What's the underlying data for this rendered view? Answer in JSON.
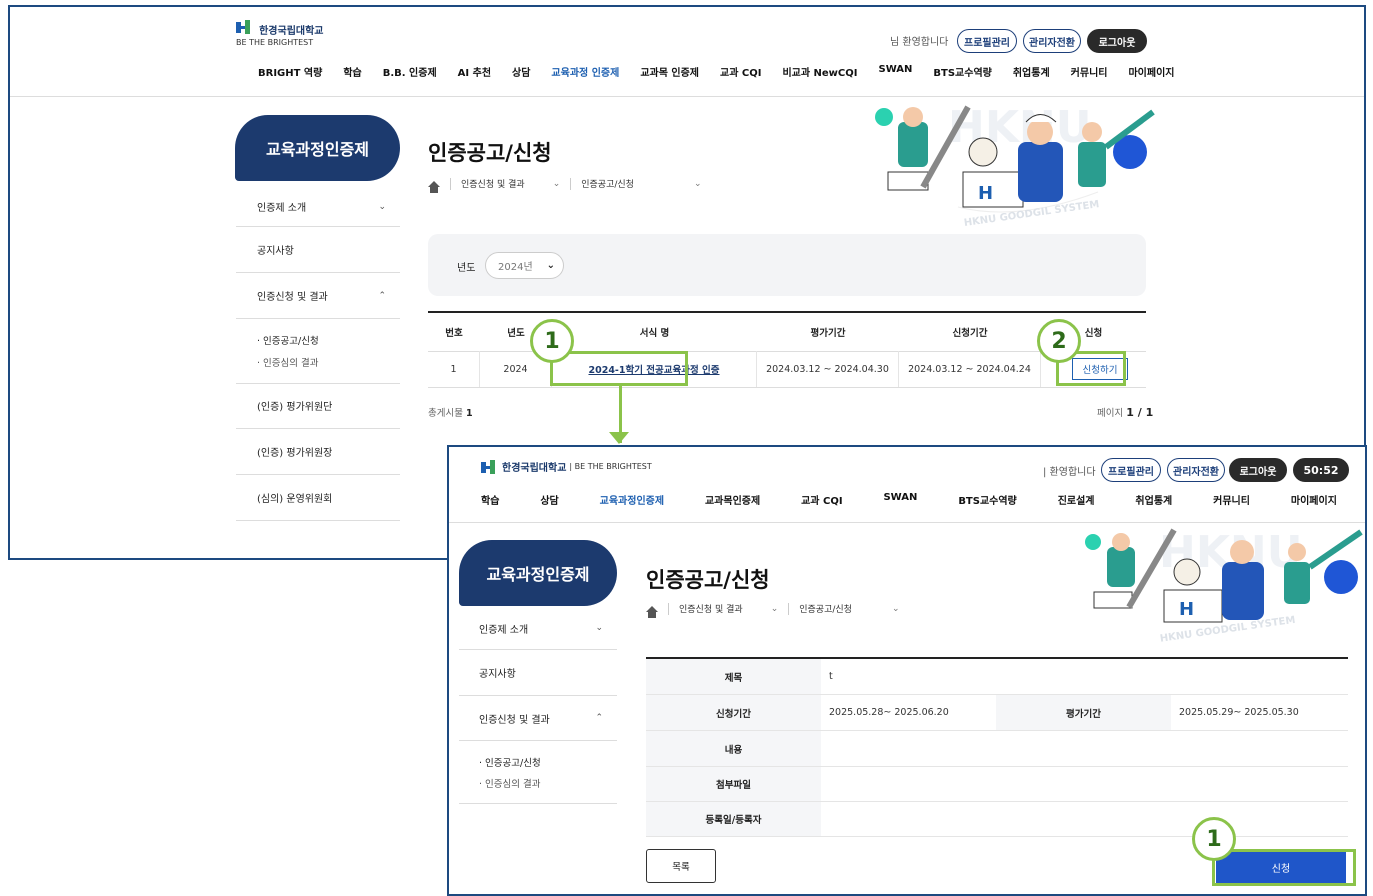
{
  "common": {
    "logo_text": "한경국립대학교",
    "logo_sub": "BE THE BRIGHTEST",
    "welcome": "님 환영합니다",
    "profile_btn": "프로필관리",
    "admin_btn": "관리자전환",
    "logout_btn": "로그아웃",
    "side_title": "교육과정인증제",
    "page_title": "인증공고/신청",
    "crumb1": "인증신청 및 결과",
    "crumb2": "인증공고/신청",
    "illus_text": "HKNU GOODGIL SYSTEM"
  },
  "shot1": {
    "nav": [
      "BRIGHT 역량",
      "학습",
      "B.B. 인증제",
      "AI 추천",
      "상담",
      "교육과정 인증제",
      "교과목 인증제",
      "교과 CQI",
      "비교과 NewCQI",
      "SWAN",
      "BTS교수역량",
      "취업통계",
      "커뮤니티",
      "마이페이지"
    ],
    "nav_active_index": 5,
    "sidebar": [
      "인증제 소개",
      "공지사항",
      "인증신청 및 결과",
      "(인증) 평가위원단",
      "(인증) 평가위원장",
      "(심의) 운영위원회"
    ],
    "sidebar_sub": [
      "인증공고/신청",
      "인증심의 결과"
    ],
    "filter_label": "년도",
    "filter_value": "2024년",
    "table_headers": [
      "번호",
      "년도",
      "서식 명",
      "평가기간",
      "신청기간",
      "신청"
    ],
    "row": {
      "no": "1",
      "year": "2024",
      "name": "2024-1학기 전공교육과정 인증",
      "eval": "2024.03.12 ~ 2024.04.30",
      "apply": "2024.03.12 ~ 2024.04.24",
      "btn": "신청하기"
    },
    "total_label": "총게시물",
    "total_value": "1",
    "page_label": "페이지",
    "page_value": "1 / 1",
    "callout1": "1",
    "callout2": "2"
  },
  "shot2": {
    "welcome": "| 환영합니다",
    "timer": "50:52",
    "logo_sub": "| BE THE BRIGHTEST",
    "nav": [
      "학습",
      "상담",
      "교육과정인증제",
      "교과목인증제",
      "교과 CQI",
      "SWAN",
      "BTS교수역량",
      "진로설계",
      "취업통계",
      "커뮤니티",
      "마이페이지"
    ],
    "nav_active_index": 2,
    "sidebar": [
      "인증제 소개",
      "공지사항",
      "인증신청 및 결과"
    ],
    "sidebar_sub": [
      "인증공고/신청",
      "인증심의 결과"
    ],
    "form": {
      "title_label": "제목",
      "title_value": "t",
      "apply_label": "신청기간",
      "apply_value": "2025.05.28~ 2025.06.20",
      "eval_label": "평가기간",
      "eval_value": "2025.05.29~ 2025.05.30",
      "content_label": "내용",
      "file_label": "첨부파일",
      "date_label": "등록일/등록자"
    },
    "list_btn": "목록",
    "apply_btn": "신청",
    "callout1": "1"
  },
  "colors": {
    "navy": "#1c3a6e",
    "accent": "#1d5fb0",
    "green": "#8bc34a",
    "apply_btn": "#1f56c9"
  }
}
